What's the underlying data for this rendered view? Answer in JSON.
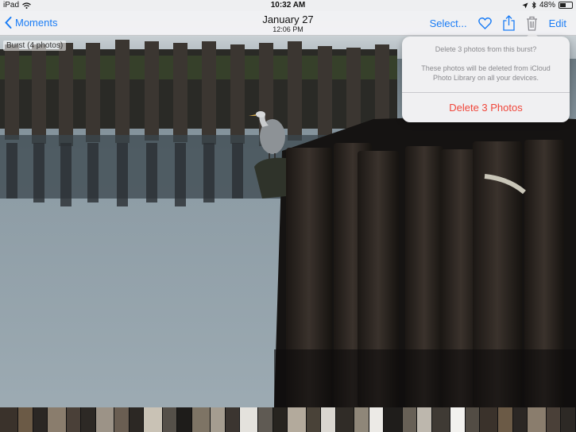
{
  "status_bar": {
    "device": "iPad",
    "time": "10:32 AM",
    "battery": "48%",
    "battery_level": 0.48,
    "icons": [
      "wifi-icon",
      "location-icon",
      "bluetooth-icon",
      "battery-icon"
    ]
  },
  "nav": {
    "back_label": "Moments",
    "title": "January 27",
    "subtitle": "12:06 PM",
    "select_label": "Select...",
    "edit_label": "Edit",
    "icons": [
      "chevron-left-icon",
      "heart-icon",
      "share-icon",
      "trash-icon"
    ]
  },
  "photo": {
    "burst_label": "Burst (4 photos)"
  },
  "popover": {
    "title": "Delete 3 photos from this burst?",
    "message": "These photos will be deleted from iCloud Photo Library on all your devices.",
    "action": "Delete 3 Photos"
  },
  "colors": {
    "accent": "#1a7cf5",
    "destructive": "#f0463a"
  }
}
